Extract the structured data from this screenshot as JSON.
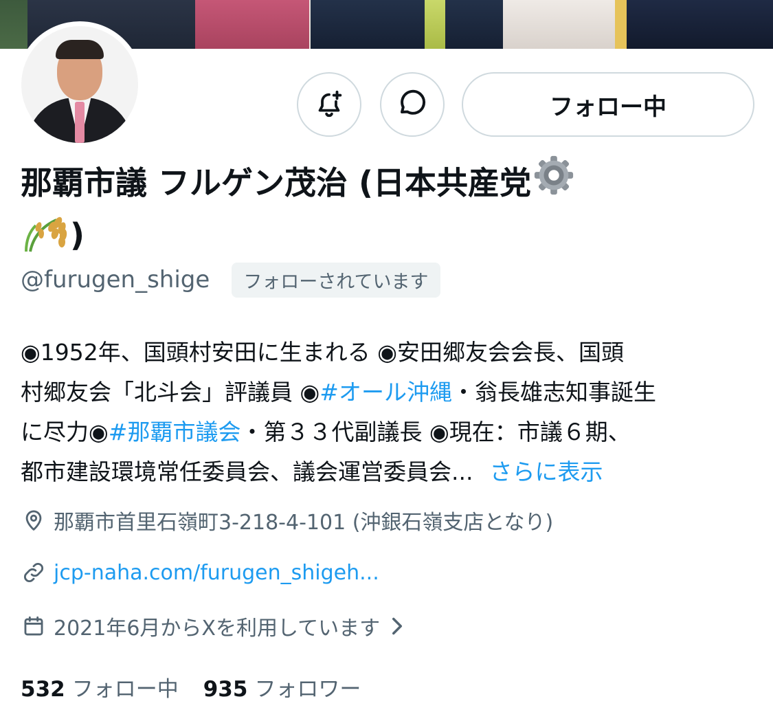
{
  "profile": {
    "name": "那覇市議 フルゲン茂治 (日本共産党",
    "name_end": ")",
    "handle": "@furugen_shige",
    "follows_you": "フォローされています"
  },
  "actions": {
    "notify_icon": "bell-plus-icon",
    "message_icon": "chat-bubble-icon",
    "follow_label": "フォロー中"
  },
  "bio": {
    "line1": "◉1952年、国頭村安田に生まれる ◉安田郷友会会長、国頭",
    "line2": "村郷友会「北斗会」評議員 ◉",
    "line2_link": "#オール沖縄",
    "line2_end": "・翁長雄志知事誕生",
    "line3_start": "に尽力◉",
    "line3_link": "#那覇市議会",
    "line3_end": "・第３３代副議長 ◉現在：市議６期、",
    "line4": "都市建設環境常任委員会、議会運営委員会...",
    "more": "さらに表示"
  },
  "meta": {
    "location": "那覇市首里石嶺町3-218-4-101 (沖銀石嶺支店となり)",
    "url": "jcp-naha.com/furugen_shigeh...",
    "joined": "2021年6月からXを利用しています"
  },
  "stats": {
    "following_count": "532",
    "following_label": "フォロー中",
    "followers_count": "935",
    "followers_label": "フォロワー"
  },
  "colors": {
    "link": "#1d9bf0",
    "secondary_text": "#536471",
    "border": "#cfd9de"
  }
}
